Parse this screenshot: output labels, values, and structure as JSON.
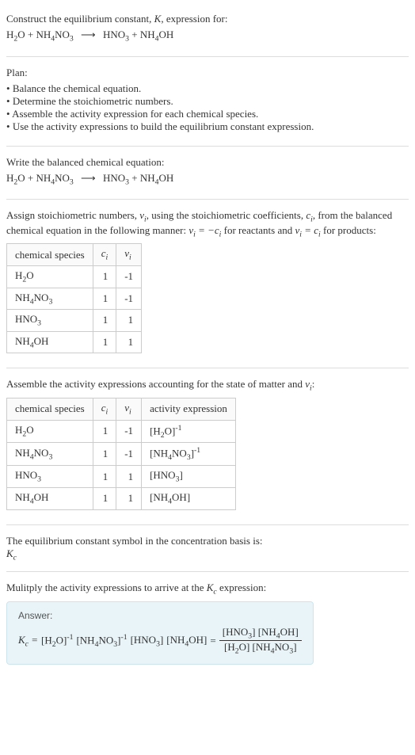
{
  "header": {
    "prompt_prefix": "Construct the equilibrium constant, ",
    "prompt_k": "K",
    "prompt_suffix": ", expression for:",
    "equation": "H₂O + NH₄NO₃  ⟶  HNO₃ + NH₄OH"
  },
  "plan": {
    "title": "Plan:",
    "items": [
      "Balance the chemical equation.",
      "Determine the stoichiometric numbers.",
      "Assemble the activity expression for each chemical species.",
      "Use the activity expressions to build the equilibrium constant expression."
    ]
  },
  "balanced": {
    "title": "Write the balanced chemical equation:",
    "equation": "H₂O + NH₄NO₃  ⟶  HNO₃ + NH₄OH"
  },
  "assign": {
    "text_prefix": "Assign stoichiometric numbers, ",
    "nu": "νᵢ",
    "text_mid1": ", using the stoichiometric coefficients, ",
    "ci": "cᵢ",
    "text_mid2": ", from the balanced chemical equation in the following manner: ",
    "eq1": "νᵢ = −cᵢ",
    "text_mid3": " for reactants and ",
    "eq2": "νᵢ = cᵢ",
    "text_suffix": " for products:"
  },
  "table1": {
    "headers": {
      "species": "chemical species",
      "ci": "cᵢ",
      "nu": "νᵢ"
    },
    "rows": [
      {
        "species": "H₂O",
        "ci": "1",
        "nu": "-1"
      },
      {
        "species": "NH₄NO₃",
        "ci": "1",
        "nu": "-1"
      },
      {
        "species": "HNO₃",
        "ci": "1",
        "nu": "1"
      },
      {
        "species": "NH₄OH",
        "ci": "1",
        "nu": "1"
      }
    ]
  },
  "assemble": {
    "text": "Assemble the activity expressions accounting for the state of matter and ",
    "nu": "νᵢ",
    "suffix": ":"
  },
  "table2": {
    "headers": {
      "species": "chemical species",
      "ci": "cᵢ",
      "nu": "νᵢ",
      "activity": "activity expression"
    },
    "rows": [
      {
        "species": "H₂O",
        "ci": "1",
        "nu": "-1",
        "activity": "[H₂O]⁻¹"
      },
      {
        "species": "NH₄NO₃",
        "ci": "1",
        "nu": "-1",
        "activity": "[NH₄NO₃]⁻¹"
      },
      {
        "species": "HNO₃",
        "ci": "1",
        "nu": "1",
        "activity": "[HNO₃]"
      },
      {
        "species": "NH₄OH",
        "ci": "1",
        "nu": "1",
        "activity": "[NH₄OH]"
      }
    ]
  },
  "symbol": {
    "text": "The equilibrium constant symbol in the concentration basis is:",
    "kc": "K_c"
  },
  "multiply": {
    "text_prefix": "Mulitply the activity expressions to arrive at the ",
    "kc": "K_c",
    "text_suffix": " expression:"
  },
  "answer": {
    "label": "Answer:",
    "lhs": "K_c = ",
    "term1": "[H₂O]⁻¹",
    "term2": "[NH₄NO₃]⁻¹",
    "term3": "[HNO₃]",
    "term4": "[NH₄OH]",
    "eq": " = ",
    "frac_num": "[HNO₃] [NH₄OH]",
    "frac_den": "[H₂O] [NH₄NO₃]"
  },
  "chart_data": {
    "type": "table",
    "tables": [
      {
        "title": "Stoichiometric numbers",
        "columns": [
          "chemical species",
          "c_i",
          "ν_i"
        ],
        "rows": [
          [
            "H2O",
            1,
            -1
          ],
          [
            "NH4NO3",
            1,
            -1
          ],
          [
            "HNO3",
            1,
            1
          ],
          [
            "NH4OH",
            1,
            1
          ]
        ]
      },
      {
        "title": "Activity expressions",
        "columns": [
          "chemical species",
          "c_i",
          "ν_i",
          "activity expression"
        ],
        "rows": [
          [
            "H2O",
            1,
            -1,
            "[H2O]^-1"
          ],
          [
            "NH4NO3",
            1,
            -1,
            "[NH4NO3]^-1"
          ],
          [
            "HNO3",
            1,
            1,
            "[HNO3]"
          ],
          [
            "NH4OH",
            1,
            1,
            "[NH4OH]"
          ]
        ]
      }
    ]
  }
}
